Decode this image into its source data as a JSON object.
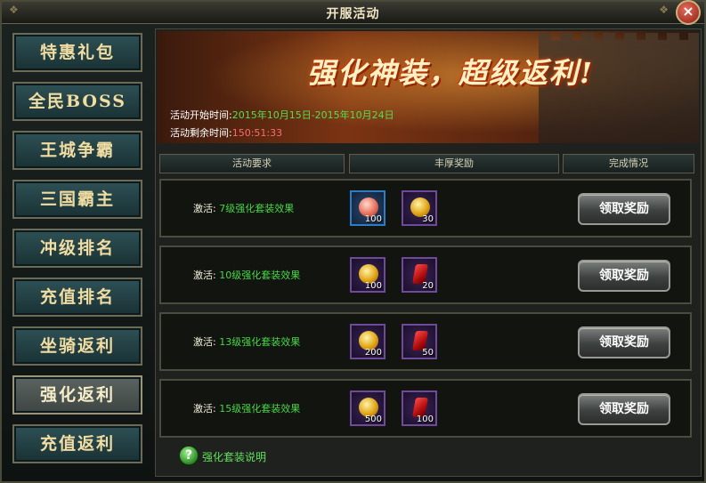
{
  "window": {
    "title": "开服活动"
  },
  "sidebar": {
    "items": [
      {
        "label": "特惠礼包"
      },
      {
        "label": "全民BOSS"
      },
      {
        "label": "王城争霸"
      },
      {
        "label": "三国霸主"
      },
      {
        "label": "冲级排名"
      },
      {
        "label": "充值排名"
      },
      {
        "label": "坐骑返利"
      },
      {
        "label": "强化返利",
        "active": true
      },
      {
        "label": "充值返利"
      }
    ]
  },
  "banner": {
    "slogan": "强化神装，超级返利!",
    "start_label": "活动开始时间:",
    "start_value": "2015年10月15日-2015年10月24日",
    "remain_label": "活动剩余时间:",
    "remain_value": "150:51:33"
  },
  "table": {
    "headers": [
      "活动要求",
      "丰厚奖励",
      "完成情况"
    ],
    "rows": [
      {
        "prefix": "激活:",
        "requirement": "7级强化套装效果",
        "rewards": [
          {
            "icon": "lace-gem-icon",
            "qty": "100"
          },
          {
            "icon": "gold-coin-icon",
            "qty": "30"
          }
        ],
        "button": "领取奖励"
      },
      {
        "prefix": "激活:",
        "requirement": "10级强化套装效果",
        "rewards": [
          {
            "icon": "gold-coin-icon",
            "qty": "100"
          },
          {
            "icon": "red-talisman-icon",
            "qty": "20"
          }
        ],
        "button": "领取奖励"
      },
      {
        "prefix": "激活:",
        "requirement": "13级强化套装效果",
        "rewards": [
          {
            "icon": "gold-coin-icon",
            "qty": "200"
          },
          {
            "icon": "red-talisman-icon",
            "qty": "50"
          }
        ],
        "button": "领取奖励"
      },
      {
        "prefix": "激活:",
        "requirement": "15级强化套装效果",
        "rewards": [
          {
            "icon": "gold-coin-icon",
            "qty": "500"
          },
          {
            "icon": "red-talisman-icon",
            "qty": "100"
          }
        ],
        "button": "领取奖励"
      }
    ]
  },
  "help": {
    "label": "强化套装说明",
    "icon": "question-icon"
  }
}
